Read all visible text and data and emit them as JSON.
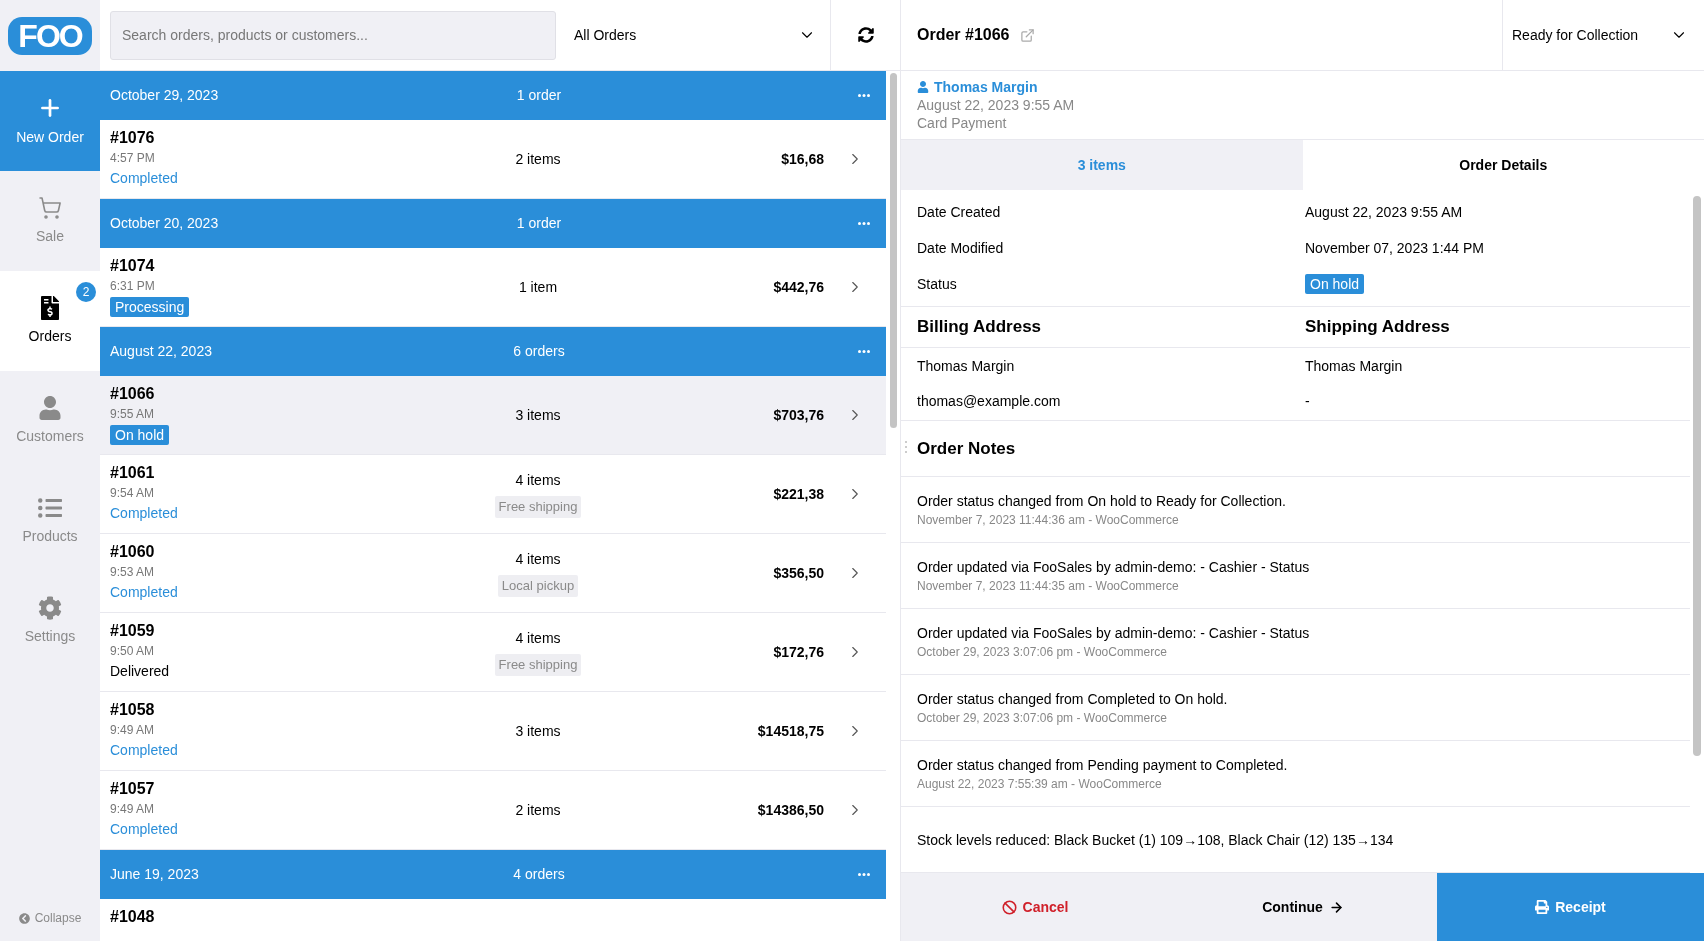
{
  "sidebar": {
    "logo": "FOO",
    "items": [
      {
        "kind": "action",
        "label": "New Order"
      },
      {
        "kind": "nav",
        "label": "Sale",
        "selected": false
      },
      {
        "kind": "nav",
        "label": "Orders",
        "selected": true,
        "badge": "2"
      },
      {
        "kind": "nav",
        "label": "Customers",
        "selected": false
      },
      {
        "kind": "nav",
        "label": "Products",
        "selected": false
      },
      {
        "kind": "nav",
        "label": "Settings",
        "selected": false
      }
    ],
    "collapse": "Collapse"
  },
  "toolbar": {
    "search": {
      "placeholder": "Search orders, products or customers..."
    },
    "filter": "All Orders"
  },
  "order_groups": [
    {
      "date": "October 29, 2023",
      "count": "1 order",
      "orders": [
        {
          "number": "#1076",
          "time": "4:57 PM",
          "status": {
            "text": "Completed",
            "kind": "accent"
          },
          "items": "2 items",
          "total": "$16,68",
          "selected": false
        }
      ]
    },
    {
      "date": "October 20, 2023",
      "count": "1 order",
      "orders": [
        {
          "number": "#1074",
          "time": "6:31 PM",
          "status": {
            "text": "Processing",
            "kind": "badge"
          },
          "items": "1 item",
          "total": "$442,76",
          "selected": false
        }
      ]
    },
    {
      "date": "August 22, 2023",
      "count": "6 orders",
      "orders": [
        {
          "number": "#1066",
          "time": "9:55 AM",
          "status": {
            "text": "On hold",
            "kind": "badge"
          },
          "items": "3 items",
          "total": "$703,76",
          "selected": true
        },
        {
          "number": "#1061",
          "time": "9:54 AM",
          "status": {
            "text": "Completed",
            "kind": "accent"
          },
          "items": "4 items",
          "shipping": "Free shipping",
          "total": "$221,38",
          "selected": false
        },
        {
          "number": "#1060",
          "time": "9:53 AM",
          "status": {
            "text": "Completed",
            "kind": "accent"
          },
          "items": "4 items",
          "shipping": "Local pickup",
          "total": "$356,50",
          "selected": false
        },
        {
          "number": "#1059",
          "time": "9:50 AM",
          "status": {
            "text": "Delivered",
            "kind": "plain"
          },
          "items": "4 items",
          "shipping": "Free shipping",
          "total": "$172,76",
          "selected": false
        },
        {
          "number": "#1058",
          "time": "9:49 AM",
          "status": {
            "text": "Completed",
            "kind": "accent"
          },
          "items": "3 items",
          "total": "$14518,75",
          "selected": false
        },
        {
          "number": "#1057",
          "time": "9:49 AM",
          "status": {
            "text": "Completed",
            "kind": "accent"
          },
          "items": "2 items",
          "total": "$14386,50",
          "selected": false
        }
      ]
    },
    {
      "date": "June 19, 2023",
      "count": "4 orders",
      "orders": [
        {
          "number": "#1048",
          "selected": false
        }
      ]
    }
  ],
  "order": {
    "title": "Order #1066",
    "status_select": "Ready for Collection",
    "customer": {
      "name": "Thomas Margin",
      "date": "August 22, 2023 9:55 AM",
      "payment": "Card Payment"
    },
    "tabs": [
      {
        "label": "3 items",
        "selected": false
      },
      {
        "label": "Order Details",
        "selected": true
      }
    ],
    "details": [
      {
        "label": "Date Created",
        "value": "August 22, 2023 9:55 AM",
        "kind": "text"
      },
      {
        "label": "Date Modified",
        "value": "November 07, 2023 1:44 PM",
        "kind": "text"
      },
      {
        "label": "Status",
        "value": "On hold",
        "kind": "badge"
      }
    ],
    "billing": {
      "heading": "Billing Address",
      "lines": [
        "Thomas Margin",
        "thomas@example.com"
      ]
    },
    "shipping": {
      "heading": "Shipping Address",
      "lines": [
        "Thomas Margin",
        "-"
      ]
    },
    "notes": {
      "heading": "Order Notes",
      "items": [
        {
          "text": "Order status changed from On hold to Ready for Collection.",
          "meta": "November 7, 2023 11:44:36 am - WooCommerce"
        },
        {
          "text": "Order updated via FooSales by admin-demo: - Cashier - Status",
          "meta": "November 7, 2023 11:44:35 am - WooCommerce"
        },
        {
          "text": "Order updated via FooSales by admin-demo: - Cashier - Status",
          "meta": "October 29, 2023 3:07:06 pm - WooCommerce"
        },
        {
          "text": "Order status changed from Completed to On hold.",
          "meta": "October 29, 2023 3:07:06 pm - WooCommerce"
        },
        {
          "text": "Order status changed from Pending payment to Completed.",
          "meta": "August 22, 2023 7:55:39 am - WooCommerce"
        },
        {
          "text": "Stock levels reduced: Black Bucket (1) 109→108, Black Chair (12) 135→134"
        }
      ]
    },
    "footer": {
      "cancel": "Cancel",
      "continue": "Continue",
      "receipt": "Receipt"
    }
  }
}
